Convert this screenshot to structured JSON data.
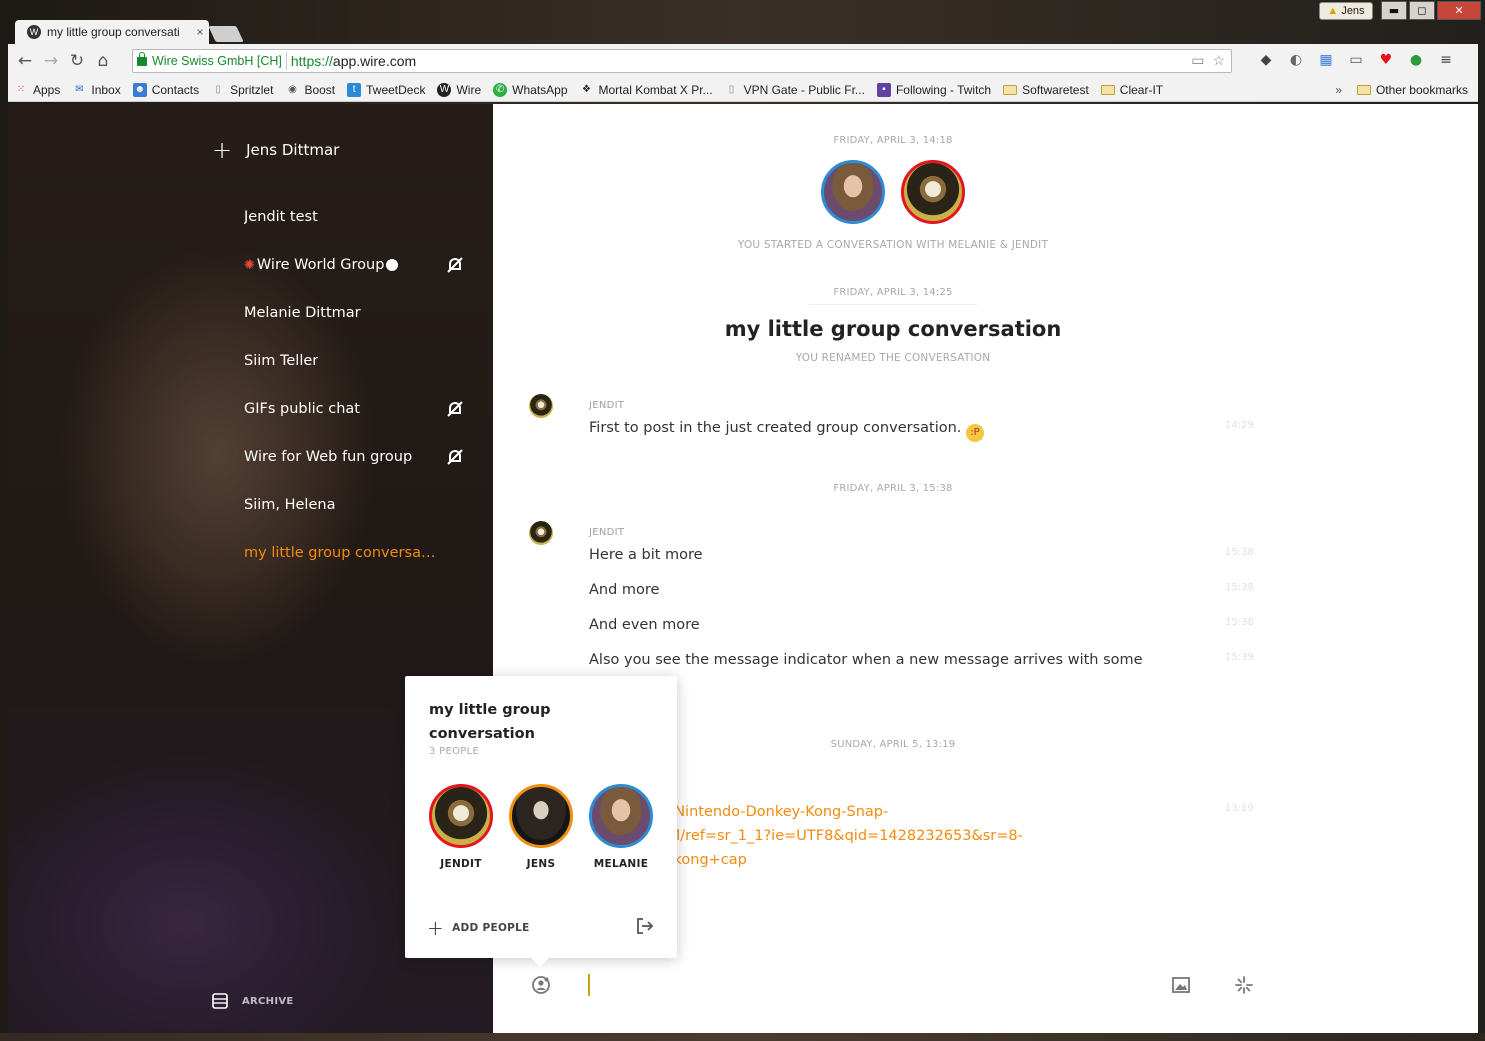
{
  "window": {
    "profile_name": "Jens",
    "min_label": "▬",
    "max_label": "◻",
    "close_label": "✕"
  },
  "tab": {
    "title": "my little group conversati",
    "close": "×"
  },
  "omnibox": {
    "ev_label": "Wire Swiss GmbH [CH]",
    "url_scheme": "https://",
    "url_host": "app.wire.com"
  },
  "bookmarks": {
    "items": [
      "Apps",
      "Inbox",
      "Contacts",
      "Spritzlet",
      "Boost",
      "TweetDeck",
      "Wire",
      "WhatsApp",
      "Mortal Kombat X Pr...",
      "VPN Gate - Public Fr...",
      "Following - Twitch",
      "Softwaretest",
      "Clear-IT"
    ],
    "more": "»",
    "other": "Other bookmarks"
  },
  "sidebar": {
    "self_name": "Jens Dittmar",
    "conversations": [
      {
        "label": "Jendit test",
        "muted": false
      },
      {
        "label": "Wire World Group",
        "muted": true
      },
      {
        "label": "Melanie Dittmar",
        "muted": false
      },
      {
        "label": "Siim Teller",
        "muted": false
      },
      {
        "label": "GIFs public chat",
        "muted": true
      },
      {
        "label": "Wire for Web fun group",
        "muted": true
      },
      {
        "label": "Siim, Helena",
        "muted": false
      },
      {
        "label": "my little group conversati...",
        "muted": false,
        "active": true
      }
    ],
    "archive_label": "ARCHIVE"
  },
  "conversation": {
    "date1": "FRIDAY, APRIL 3, 14:18",
    "started_caption": "YOU STARTED A CONVERSATION WITH MELANIE & JENDIT",
    "date2": "FRIDAY, APRIL 3, 14:25",
    "title": "my little group conversation",
    "renamed_caption": "YOU RENAMED THE CONVERSATION",
    "msg_group1": {
      "sender": "JENDIT",
      "messages": [
        {
          "text": "First to post in the just created group conversation.",
          "time": "14:29"
        }
      ]
    },
    "date3": "FRIDAY, APRIL 3, 15:38",
    "msg_group2": {
      "sender": "JENDIT",
      "messages": [
        {
          "text": "Here a bit more",
          "time": "15:38"
        },
        {
          "text": "And more",
          "time": "15:38"
        },
        {
          "text": "And even more",
          "time": "15:38"
        },
        {
          "text": "Also you see the message indicator when a new message arrives with some",
          "time": "15:39"
        }
      ]
    },
    "date4": "SUNDAY, APRIL 5, 13:19",
    "link_lines": [
      "amazon.de/Nintendo-Donkey-Kong-Snap-",
      "00K0MAB0M/ref=sr_1_1?ie=UTF8&qid=1428232653&sr=8-",
      "s=donkey+kong+cap"
    ],
    "link_time": "13:19"
  },
  "popover": {
    "title": "my little group conversation",
    "count": "3 PEOPLE",
    "members": [
      "JENDIT",
      "JENS",
      "MELANIE"
    ],
    "add_label": "ADD PEOPLE"
  },
  "colors": {
    "accent": "#f28b0f",
    "ev_green": "#168a2a",
    "ring_blue": "#2f8cd4",
    "ring_red": "#e5161f",
    "ring_orange": "#f09010"
  }
}
